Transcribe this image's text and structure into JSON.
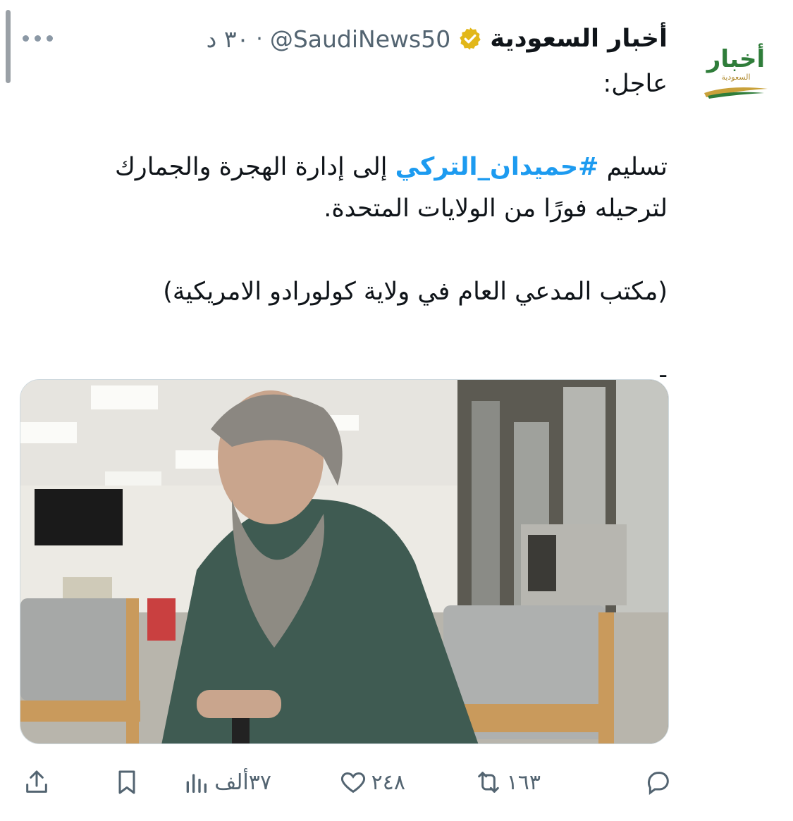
{
  "account": {
    "display_name": "أخبار السعودية",
    "handle": "@SaudiNews50",
    "separator": "·",
    "timestamp": "٣٠ د",
    "avatar_logo": {
      "main": "أخبار",
      "sub": "السعودية"
    }
  },
  "tweet": {
    "line1": "عاجل:",
    "line2_prefix": "تسليم ",
    "hashtag": "#حميدان_التركي",
    "line2_suffix": " إلى إدارة الهجرة والجمارك",
    "line3": "لترحيله فورًا من الولايات المتحدة.",
    "line4": "(مكتب المدعي العام في ولاية كولورادو الامريكية)",
    "line5": "-"
  },
  "media": {
    "icon": "photo-image"
  },
  "actions": {
    "reply": {
      "icon": "reply-icon",
      "count": ""
    },
    "retweet": {
      "icon": "retweet-icon",
      "count": "١٦٣"
    },
    "like": {
      "icon": "heart-icon",
      "count": "٢٤٨"
    },
    "views": {
      "icon": "views-chart-icon",
      "count": "٣٧ألف"
    },
    "bookmark": {
      "icon": "bookmark-icon"
    },
    "share": {
      "icon": "share-icon"
    }
  },
  "colors": {
    "text": "#0f1419",
    "secondary": "#536471",
    "link": "#1d9bf0",
    "verified_gold": "#e2b719"
  }
}
